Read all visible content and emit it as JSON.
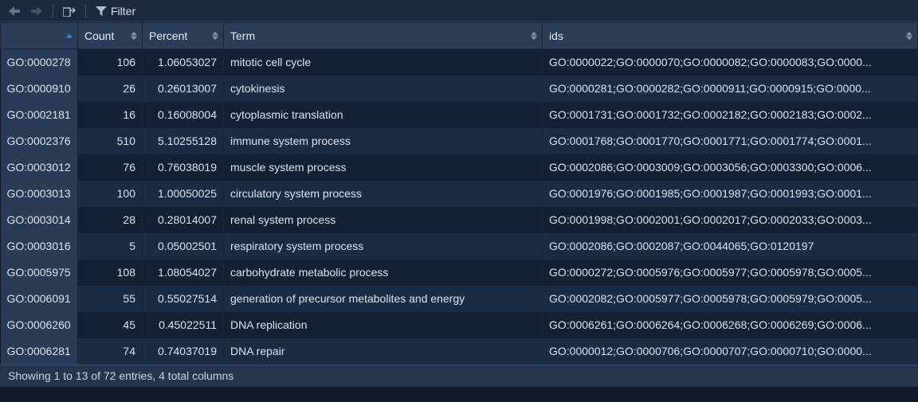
{
  "toolbar": {
    "filter_label": "Filter"
  },
  "columns": {
    "id": "",
    "count": "Count",
    "percent": "Percent",
    "term": "Term",
    "ids": "ids"
  },
  "rows": [
    {
      "id": "GO:0000278",
      "count": "106",
      "percent": "1.06053027",
      "term": "mitotic cell cycle",
      "ids": "GO:0000022;GO:0000070;GO:0000082;GO:0000083;GO:0000..."
    },
    {
      "id": "GO:0000910",
      "count": "26",
      "percent": "0.26013007",
      "term": "cytokinesis",
      "ids": "GO:0000281;GO:0000282;GO:0000911;GO:0000915;GO:0000..."
    },
    {
      "id": "GO:0002181",
      "count": "16",
      "percent": "0.16008004",
      "term": "cytoplasmic translation",
      "ids": "GO:0001731;GO:0001732;GO:0002182;GO:0002183;GO:0002..."
    },
    {
      "id": "GO:0002376",
      "count": "510",
      "percent": "5.10255128",
      "term": "immune system process",
      "ids": "GO:0001768;GO:0001770;GO:0001771;GO:0001774;GO:0001..."
    },
    {
      "id": "GO:0003012",
      "count": "76",
      "percent": "0.76038019",
      "term": "muscle system process",
      "ids": "GO:0002086;GO:0003009;GO:0003056;GO:0003300;GO:0006..."
    },
    {
      "id": "GO:0003013",
      "count": "100",
      "percent": "1.00050025",
      "term": "circulatory system process",
      "ids": "GO:0001976;GO:0001985;GO:0001987;GO:0001993;GO:0001..."
    },
    {
      "id": "GO:0003014",
      "count": "28",
      "percent": "0.28014007",
      "term": "renal system process",
      "ids": "GO:0001998;GO:0002001;GO:0002017;GO:0002033;GO:0003..."
    },
    {
      "id": "GO:0003016",
      "count": "5",
      "percent": "0.05002501",
      "term": "respiratory system process",
      "ids": "GO:0002086;GO:0002087;GO:0044065;GO:0120197"
    },
    {
      "id": "GO:0005975",
      "count": "108",
      "percent": "1.08054027",
      "term": "carbohydrate metabolic process",
      "ids": "GO:0000272;GO:0005976;GO:0005977;GO:0005978;GO:0005..."
    },
    {
      "id": "GO:0006091",
      "count": "55",
      "percent": "0.55027514",
      "term": "generation of precursor metabolites and energy",
      "ids": "GO:0002082;GO:0005977;GO:0005978;GO:0005979;GO:0005..."
    },
    {
      "id": "GO:0006260",
      "count": "45",
      "percent": "0.45022511",
      "term": "DNA replication",
      "ids": "GO:0006261;GO:0006264;GO:0006268;GO:0006269;GO:0006..."
    },
    {
      "id": "GO:0006281",
      "count": "74",
      "percent": "0.74037019",
      "term": "DNA repair",
      "ids": "GO:0000012;GO:0000706;GO:0000707;GO:0000710;GO:0000..."
    }
  ],
  "status": "Showing 1 to 13 of 72 entries, 4 total columns"
}
